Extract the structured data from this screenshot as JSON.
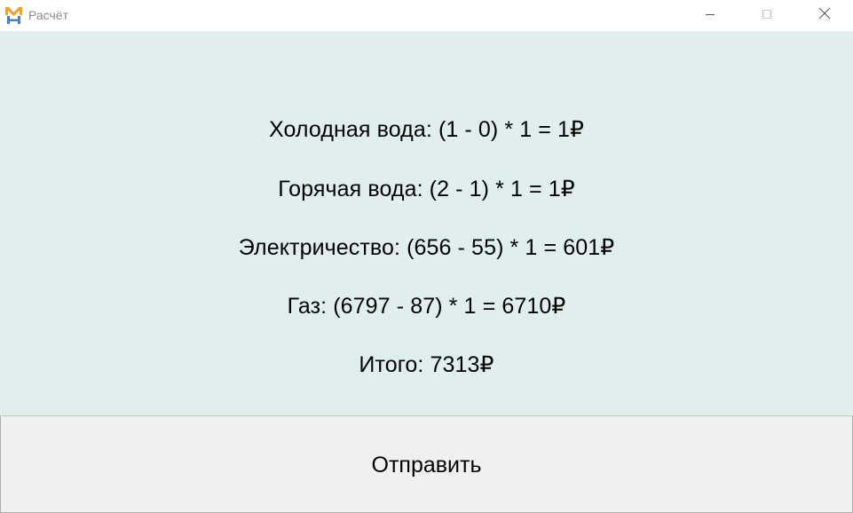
{
  "window": {
    "title": "Расчёт",
    "controls": {
      "minimize_icon": "minimize-icon",
      "maximize_icon": "maximize-icon",
      "close_icon": "close-icon"
    }
  },
  "results": {
    "cold_water": "Холодная вода: (1 - 0) *  1 = 1₽",
    "hot_water": "Горячая вода: (2 - 1) * 1 = 1₽",
    "electricity": "Электричество: (656 - 55) * 1 = 601₽",
    "gas": "Газ: (6797 - 87) * 1 = 6710₽",
    "total": "Итого: 7313₽"
  },
  "actions": {
    "send_label": "Отправить"
  },
  "colors": {
    "content_bg": "#e0eeed",
    "button_bg": "#f0f0f0",
    "title_text": "#8a8a8a",
    "icon_orange": "#f2a135",
    "icon_blue": "#4a7fc0"
  }
}
